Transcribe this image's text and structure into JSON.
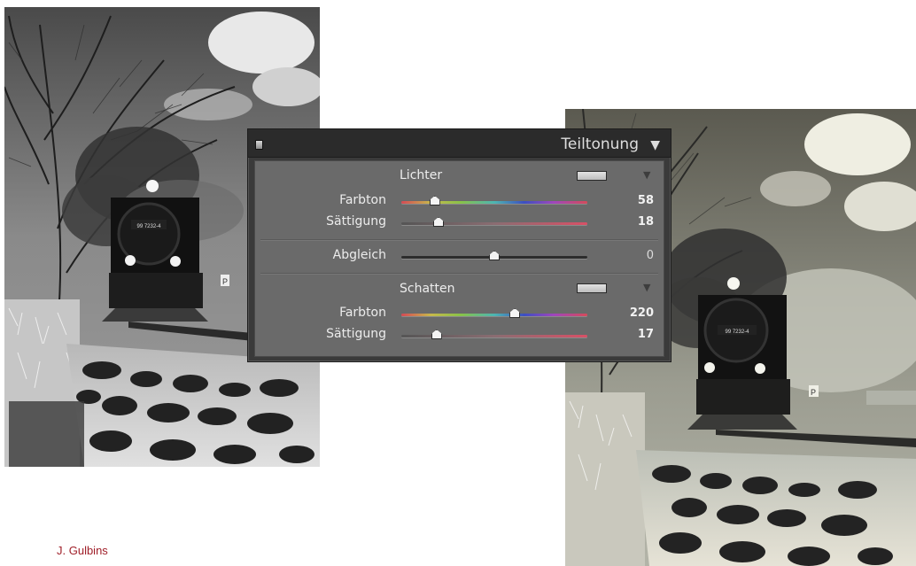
{
  "panel": {
    "title": "Teiltonung",
    "highlights": {
      "heading": "Lichter",
      "hue": {
        "label": "Farbton",
        "value": "58",
        "fraction": 0.18
      },
      "saturation": {
        "label": "Sättigung",
        "value": "18",
        "fraction": 0.2
      }
    },
    "balance": {
      "label": "Abgleich",
      "value": "0",
      "fraction": 0.5
    },
    "shadows": {
      "heading": "Schatten",
      "hue": {
        "label": "Farbton",
        "value": "220",
        "fraction": 0.61
      },
      "saturation": {
        "label": "Sättigung",
        "value": "17",
        "fraction": 0.19
      }
    }
  },
  "photo_left": {
    "plate": "99 7232-4",
    "sign": "P"
  },
  "photo_right": {
    "plate": "99 7232-4",
    "sign": "P"
  },
  "credit": "J. Gulbins",
  "colors": {
    "credit": "#a0202a",
    "panel_bg": "#3a3a3a",
    "panel_body": "#6a6a6a"
  }
}
